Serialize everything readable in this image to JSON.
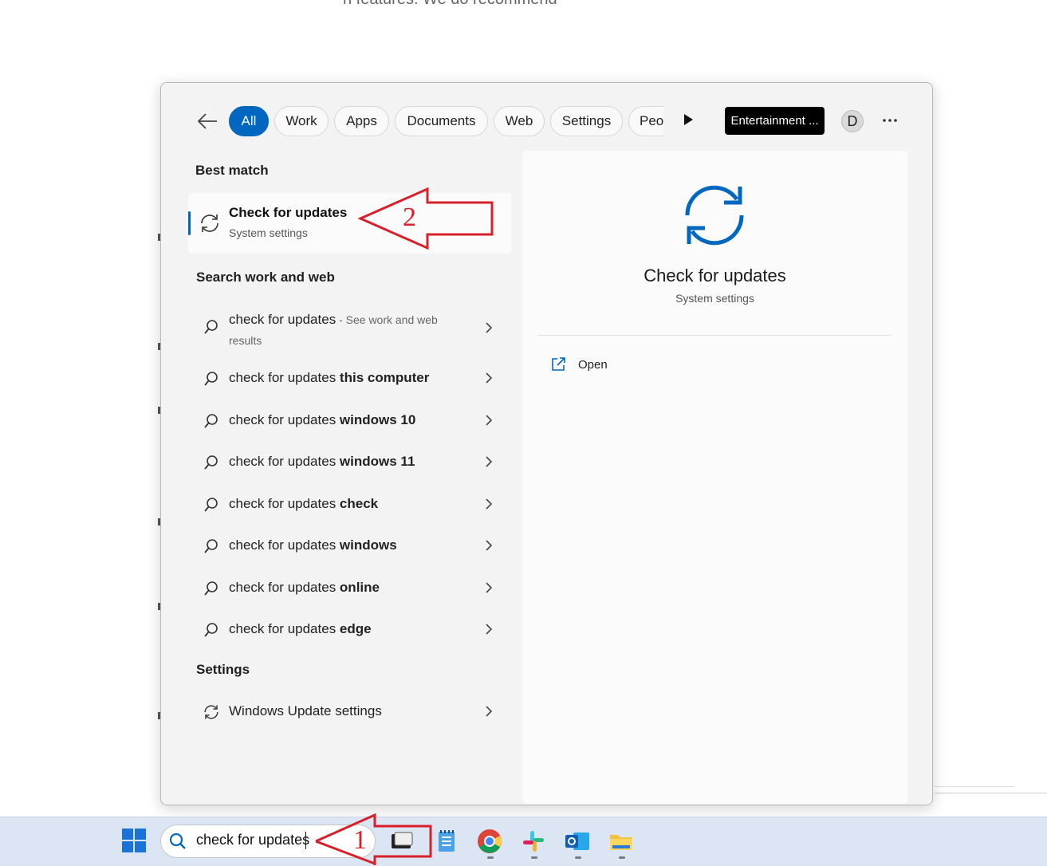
{
  "background": {
    "partial_text": "n features. We do recommend"
  },
  "filters": {
    "tabs": [
      "All",
      "Work",
      "Apps",
      "Documents",
      "Web",
      "Settings",
      "Peop"
    ],
    "active_tab": "All",
    "entertainment_label": "Entertainment ...",
    "avatar_initial": "D"
  },
  "best_match": {
    "heading": "Best match",
    "title": "Check for updates",
    "subtitle": "System settings"
  },
  "search_web": {
    "heading": "Search work and web",
    "first": {
      "query": "check for updates",
      "suffix": " - See work and web results"
    },
    "suggestions": [
      {
        "base": "check for updates ",
        "bold": "this computer"
      },
      {
        "base": "check for updates ",
        "bold": "windows 10"
      },
      {
        "base": "check for updates ",
        "bold": "windows 11"
      },
      {
        "base": "check for updates ",
        "bold": "check"
      },
      {
        "base": "check for updates ",
        "bold": "windows"
      },
      {
        "base": "check for updates ",
        "bold": "online"
      },
      {
        "base": "check for updates ",
        "bold": "edge"
      }
    ]
  },
  "settings_section": {
    "heading": "Settings",
    "item": "Windows Update settings"
  },
  "preview": {
    "title": "Check for updates",
    "subtitle": "System settings",
    "action_open": "Open"
  },
  "taskbar": {
    "search_value": "check for updates",
    "apps": [
      "task-view-icon",
      "notepad-icon",
      "chrome-icon",
      "slack-icon",
      "outlook-icon",
      "file-explorer-icon"
    ]
  },
  "annotations": {
    "arrow1_number": "1",
    "arrow2_number": "2"
  },
  "colors": {
    "accent": "#0067c0",
    "annotation": "#d8202a"
  }
}
